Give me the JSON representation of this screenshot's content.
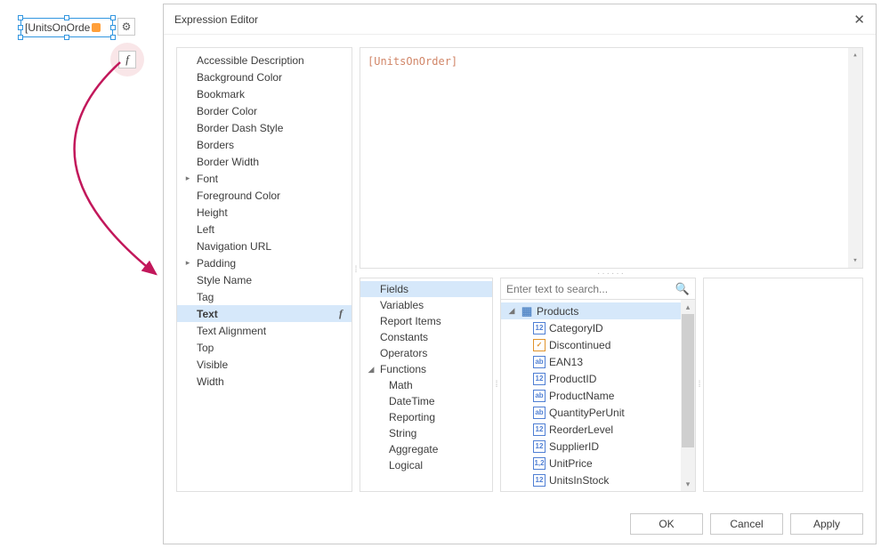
{
  "canvas": {
    "field_text": "[UnitsOnOrde",
    "f_button_label": "f"
  },
  "dialog": {
    "title": "Expression Editor",
    "expression": "[UnitsOnOrder]",
    "properties": [
      {
        "label": "Accessible Description",
        "expand": ""
      },
      {
        "label": "Background Color",
        "expand": ""
      },
      {
        "label": "Bookmark",
        "expand": ""
      },
      {
        "label": "Border Color",
        "expand": ""
      },
      {
        "label": "Border Dash Style",
        "expand": ""
      },
      {
        "label": "Borders",
        "expand": ""
      },
      {
        "label": "Border Width",
        "expand": ""
      },
      {
        "label": "Font",
        "expand": "▸"
      },
      {
        "label": "Foreground Color",
        "expand": ""
      },
      {
        "label": "Height",
        "expand": ""
      },
      {
        "label": "Left",
        "expand": ""
      },
      {
        "label": "Navigation URL",
        "expand": ""
      },
      {
        "label": "Padding",
        "expand": "▸"
      },
      {
        "label": "Style Name",
        "expand": ""
      },
      {
        "label": "Tag",
        "expand": ""
      },
      {
        "label": "Text",
        "expand": "",
        "selected": true,
        "fx": true
      },
      {
        "label": "Text Alignment",
        "expand": ""
      },
      {
        "label": "Top",
        "expand": ""
      },
      {
        "label": "Visible",
        "expand": ""
      },
      {
        "label": "Width",
        "expand": ""
      }
    ],
    "categories": {
      "items": [
        {
          "label": "Fields",
          "selected": true
        },
        {
          "label": "Variables"
        },
        {
          "label": "Report Items"
        },
        {
          "label": "Constants"
        },
        {
          "label": "Operators"
        },
        {
          "label": "Functions",
          "expand": "◢",
          "children": [
            {
              "label": "Math"
            },
            {
              "label": "DateTime"
            },
            {
              "label": "Reporting"
            },
            {
              "label": "String"
            },
            {
              "label": "Aggregate"
            },
            {
              "label": "Logical"
            }
          ]
        }
      ]
    },
    "search_placeholder": "Enter text to search...",
    "fields_tree": {
      "root": "Products",
      "items": [
        {
          "label": "CategoryID",
          "type": "12"
        },
        {
          "label": "Discontinued",
          "type": "chk"
        },
        {
          "label": "EAN13",
          "type": "ab"
        },
        {
          "label": "ProductID",
          "type": "12"
        },
        {
          "label": "ProductName",
          "type": "ab"
        },
        {
          "label": "QuantityPerUnit",
          "type": "ab"
        },
        {
          "label": "ReorderLevel",
          "type": "12"
        },
        {
          "label": "SupplierID",
          "type": "12"
        },
        {
          "label": "UnitPrice",
          "type": "12c"
        },
        {
          "label": "UnitsInStock",
          "type": "12"
        }
      ]
    },
    "buttons": {
      "ok": "OK",
      "cancel": "Cancel",
      "apply": "Apply"
    }
  }
}
